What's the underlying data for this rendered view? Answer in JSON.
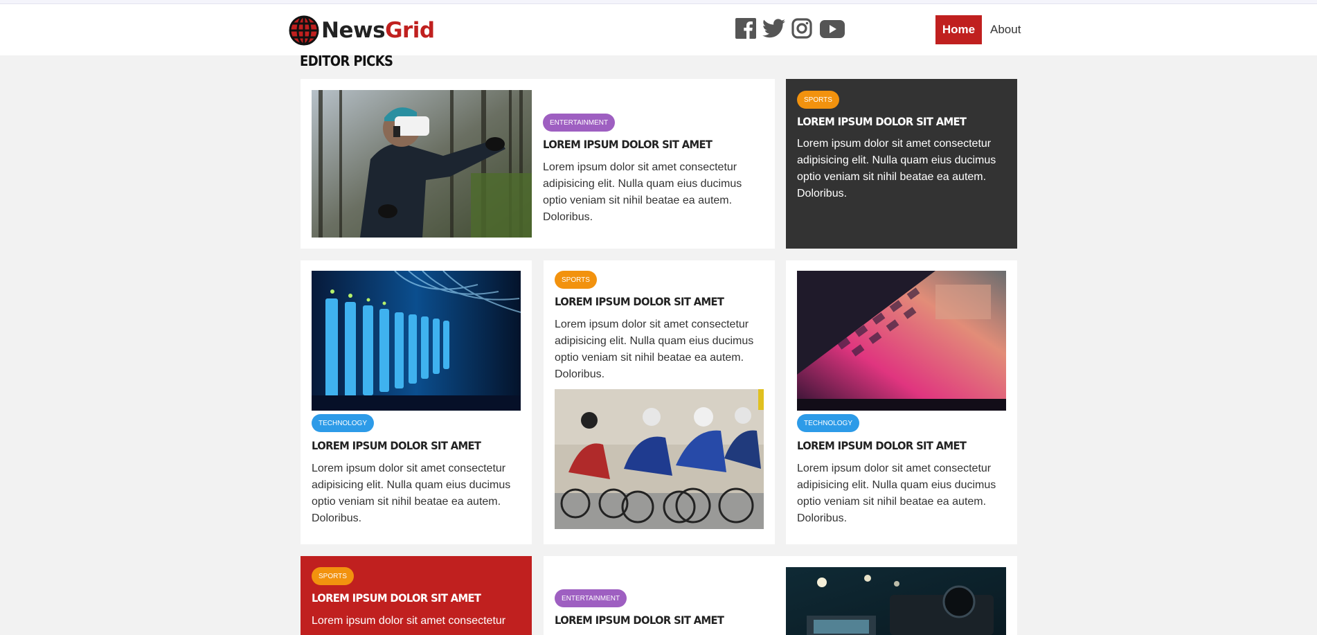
{
  "brand": {
    "name_part1": "News",
    "name_part2": "Grid",
    "accent": "#c0201f"
  },
  "social": [
    "facebook-icon",
    "twitter-icon",
    "instagram-icon",
    "youtube-icon"
  ],
  "nav": {
    "home": "Home",
    "about": "About"
  },
  "section": {
    "title": "EDITOR PICKS"
  },
  "colors": {
    "entertainment": "#9e5fc1",
    "sports": "#f2920e",
    "technology": "#2d9be8",
    "dark_card": "#333333",
    "red_card": "#c0201f"
  },
  "cards": [
    {
      "category": "ENTERTAINMENT",
      "title": "LOREM IPSUM DOLOR SIT AMET",
      "text": "Lorem ipsum dolor sit amet consectetur adipisicing elit. Nulla quam eius ducimus optio veniam sit nihil beatae ea autem. Doloribus."
    },
    {
      "category": "SPORTS",
      "title": "LOREM IPSUM DOLOR SIT AMET",
      "text": "Lorem ipsum dolor sit amet consectetur adipisicing elit. Nulla quam eius ducimus optio veniam sit nihil beatae ea autem. Doloribus."
    },
    {
      "category": "TECHNOLOGY",
      "title": "LOREM IPSUM DOLOR SIT AMET",
      "text": "Lorem ipsum dolor sit amet consectetur adipisicing elit. Nulla quam eius ducimus optio veniam sit nihil beatae ea autem. Doloribus."
    },
    {
      "category": "SPORTS",
      "title": "LOREM IPSUM DOLOR SIT AMET",
      "text": "Lorem ipsum dolor sit amet consectetur adipisicing elit. Nulla quam eius ducimus optio veniam sit nihil beatae ea autem. Doloribus."
    },
    {
      "category": "TECHNOLOGY",
      "title": "LOREM IPSUM DOLOR SIT AMET",
      "text": "Lorem ipsum dolor sit amet consectetur adipisicing elit. Nulla quam eius ducimus optio veniam sit nihil beatae ea autem. Doloribus."
    },
    {
      "category": "SPORTS",
      "title": "LOREM IPSUM DOLOR SIT AMET",
      "text": "Lorem ipsum dolor sit amet consectetur"
    },
    {
      "category": "ENTERTAINMENT",
      "title": "LOREM IPSUM DOLOR SIT AMET"
    }
  ]
}
